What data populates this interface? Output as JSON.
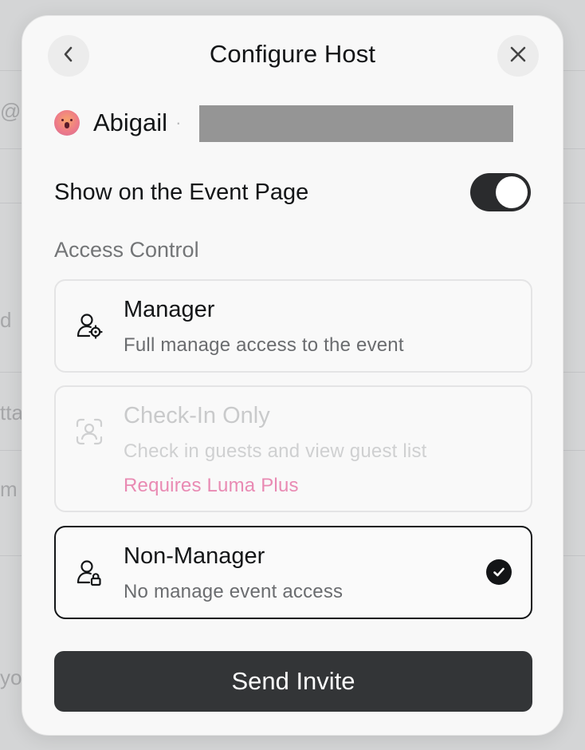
{
  "background": {
    "fragments": [
      "@p",
      "d",
      "tta",
      "m",
      "yo"
    ]
  },
  "modal": {
    "title": "Configure Host",
    "host": {
      "name": "Abigail",
      "separator": "·"
    },
    "show_on_event_page": {
      "label": "Show on the Event Page",
      "enabled": true
    },
    "access_control": {
      "label": "Access Control",
      "options": [
        {
          "title": "Manager",
          "description": "Full manage access to the event",
          "selected": false,
          "disabled": false,
          "icon": "user-gear-icon"
        },
        {
          "title": "Check-In Only",
          "description": "Check in guests and view guest list",
          "note": "Requires Luma Plus",
          "selected": false,
          "disabled": true,
          "icon": "user-scan-icon"
        },
        {
          "title": "Non-Manager",
          "description": "No manage event access",
          "selected": true,
          "disabled": false,
          "icon": "user-lock-icon"
        }
      ]
    },
    "submit_label": "Send Invite"
  },
  "colors": {
    "accent_note": "#e98ab3",
    "primary_button": "#333537",
    "toggle_on": "#2a2b2d"
  }
}
